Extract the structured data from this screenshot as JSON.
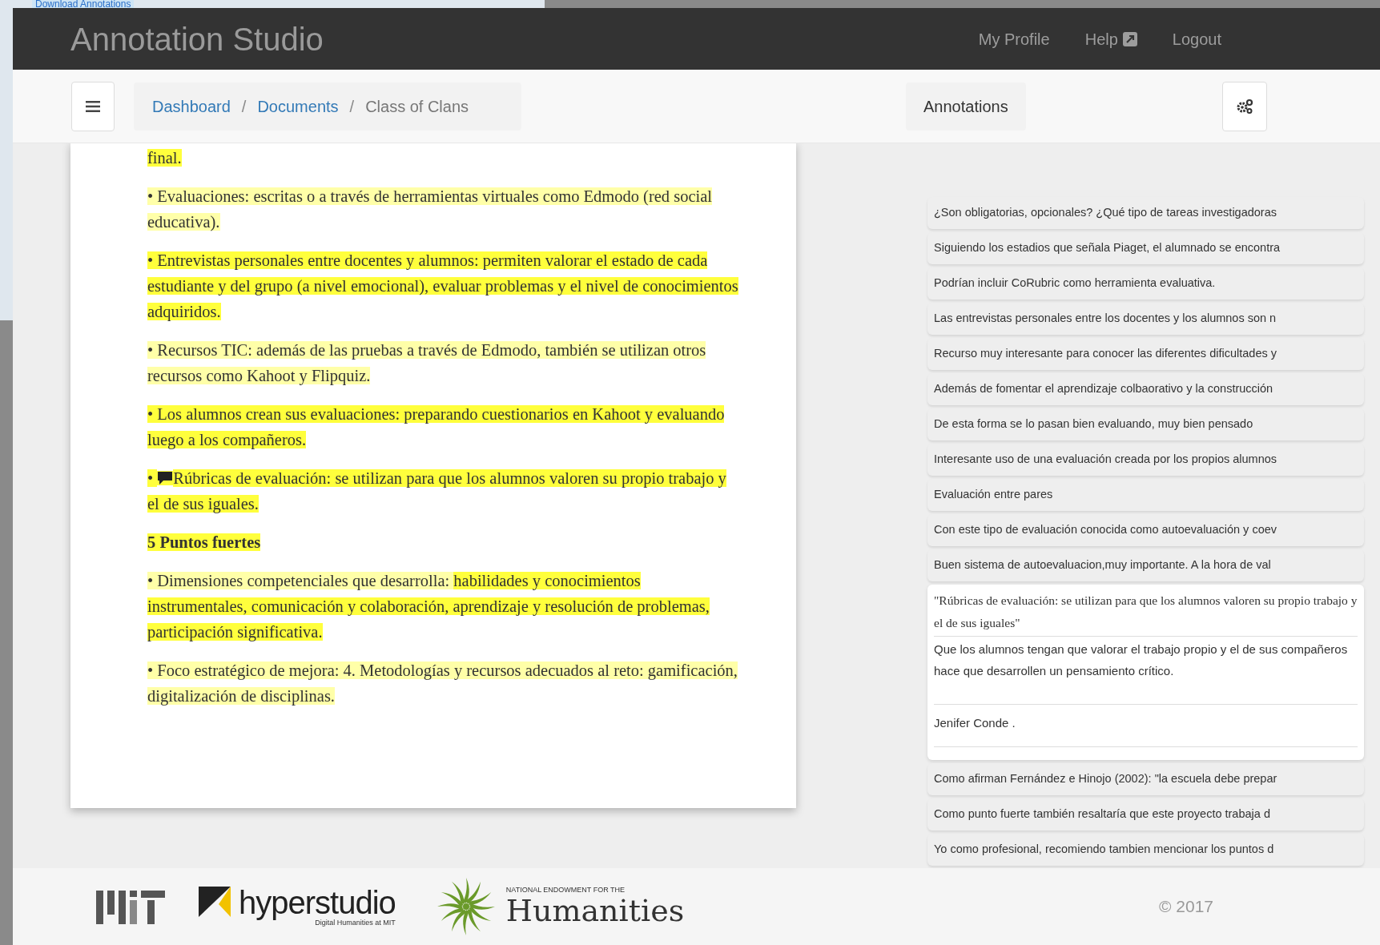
{
  "background_window": {
    "link": "Download Annotations"
  },
  "app": {
    "title": "Annotation Studio",
    "nav": [
      {
        "label": "My Profile",
        "kind": "link"
      },
      {
        "label": "Help",
        "kind": "external"
      },
      {
        "label": "Logout",
        "kind": "link"
      }
    ]
  },
  "breadcrumb": {
    "separator": "/",
    "items": [
      {
        "label": "Dashboard",
        "current": false
      },
      {
        "label": "Documents",
        "current": false
      },
      {
        "label": "Class of Clans",
        "current": true
      }
    ]
  },
  "annotations_tab": {
    "label": "Annotations"
  },
  "document": {
    "paragraphs": [
      {
        "kind": "text",
        "comment": false,
        "segments": [
          {
            "text": "final.",
            "color": "#ffff3c"
          }
        ]
      },
      {
        "kind": "text",
        "comment": false,
        "segments": [
          {
            "text": "• Evaluaciones: escritas o a través de herramientas virtuales como Edmodo (red social educativa).",
            "color": "#ffffa8"
          }
        ]
      },
      {
        "kind": "text",
        "comment": false,
        "segments": [
          {
            "text": "• Entrevistas personales entre docentes y alumnos: permiten valorar el estado de cada estudiante y del grupo (a nivel emocional), evaluar problemas y el nivel de conocimientos adquiridos.",
            "color": "#ffff3c"
          }
        ]
      },
      {
        "kind": "text",
        "comment": false,
        "segments": [
          {
            "text": "• Recursos TIC: además de las pruebas a través de Edmodo, también se utilizan otros recursos como Kahoot y Flipquiz.",
            "color": "#ffffa8"
          }
        ]
      },
      {
        "kind": "text",
        "comment": false,
        "segments": [
          {
            "text": "• Los alumnos crean sus evaluaciones: preparando cuestionarios en Kahoot y evaluando luego a los compañeros.",
            "color": "#ffff3c"
          }
        ]
      },
      {
        "kind": "text",
        "comment": true,
        "segments": [
          {
            "text": "• ",
            "color": "#ffff3c"
          },
          {
            "text": "Rúbricas de evaluación: se utilizan para que los alumnos valoren su propio trabajo y el de sus iguales.",
            "color": "#ffff3c"
          }
        ]
      },
      {
        "kind": "heading",
        "comment": false,
        "segments": [
          {
            "text": "5 Puntos fuertes",
            "color": "#ffff3c"
          }
        ]
      },
      {
        "kind": "text",
        "comment": false,
        "segments": [
          {
            "text": "• Dimensiones competenciales que desarrolla: ",
            "color": "#ffffa8"
          },
          {
            "text": "habilidades y conocimientos instrumentales, comunicación y colaboración, aprendizaje y resolución de problemas, participación significativa.",
            "color": "#ffff3c"
          }
        ]
      },
      {
        "kind": "text",
        "comment": false,
        "segments": [
          {
            "text": "• Foco estratégico de mejora: 4. Metodologías y recursos adecuados al reto: gamificación, digitalización de disciplinas.",
            "color": "#ffffa8"
          }
        ]
      }
    ]
  },
  "annotations": [
    {
      "expanded": false,
      "text": "¿Son obligatorias, opcionales? ¿Qué tipo de tareas investigadoras"
    },
    {
      "expanded": false,
      "text": "Siguiendo los estadios que señala Piaget, el alumnado se encontra"
    },
    {
      "expanded": false,
      "text": "Podrían incluir CoRubric como herramienta evaluativa."
    },
    {
      "expanded": false,
      "text": "Las entrevistas personales entre los docentes y los alumnos son n"
    },
    {
      "expanded": false,
      "text": "Recurso muy interesante para conocer las diferentes dificultades y"
    },
    {
      "expanded": false,
      "text": "Además de fomentar el aprendizaje colbaorativo y la construcción"
    },
    {
      "expanded": false,
      "text": "De esta forma se lo pasan bien evaluando, muy bien pensado"
    },
    {
      "expanded": false,
      "text": "Interesante uso de una evaluación creada por los propios alumnos"
    },
    {
      "expanded": false,
      "text": "Evaluación entre pares"
    },
    {
      "expanded": false,
      "text": "Con este tipo de evaluación conocida como autoevaluación y coev"
    },
    {
      "expanded": false,
      "text": "Buen sistema de autoevaluacion,muy importante. A la hora de val"
    },
    {
      "expanded": true,
      "quote": "\"Rúbricas de evaluación: se utilizan para que los alumnos valoren su propio trabajo y el de sus iguales\"",
      "text": "Que los alumnos tengan que valorar el trabajo propio y el de sus compañeros hace que desarrollen un pensamiento crítico.",
      "author": "Jenifer Conde ."
    },
    {
      "expanded": false,
      "text": "Como afirman Fernández e Hinojo (2002): \"la escuela debe prepar"
    },
    {
      "expanded": false,
      "text": "Como punto fuerte también resaltaría que este proyecto trabaja d"
    },
    {
      "expanded": false,
      "text": "Yo como profesional, recomiendo tambien mencionar los puntos d"
    }
  ],
  "footer": {
    "logos": [
      {
        "kind": "mit"
      },
      {
        "kind": "hyperstudio",
        "name": "hyperstudio",
        "tagline": "Digital Humanities at MIT"
      },
      {
        "kind": "neh",
        "overline": "NATIONAL ENDOWMENT FOR THE",
        "name": "Humanities"
      }
    ],
    "copyright": "© 2017"
  }
}
